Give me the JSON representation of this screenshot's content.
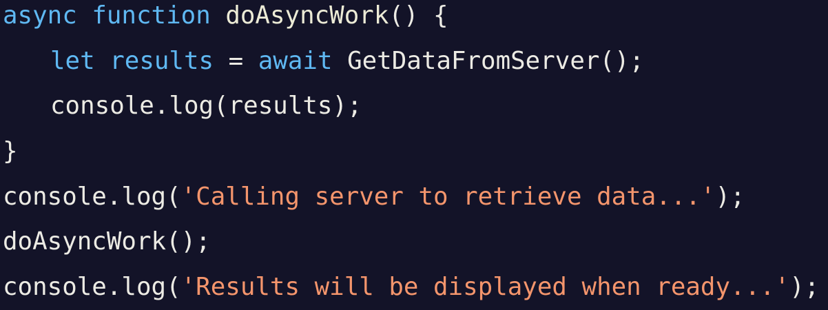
{
  "code": {
    "lines": [
      {
        "kw1": "async",
        "kw2": "function",
        "name": "doAsyncWork",
        "rest": "() {"
      },
      {
        "kw1": "let",
        "var": "results",
        "op": " = ",
        "kw2": "await",
        "rest": " GetDataFromServer();"
      },
      {
        "text": "console.log(results);"
      },
      {
        "text": "}"
      },
      {
        "pre": "console.log(",
        "str": "'Calling server to retrieve data...'",
        "post": ");"
      },
      {
        "text": "doAsyncWork();"
      },
      {
        "pre": "console.log(",
        "str": "'Results will be displayed when ready...'",
        "post": ");"
      }
    ]
  },
  "colors": {
    "background": "#131328",
    "keyword": "#5fb8f2",
    "string": "#f4956c",
    "text": "#ecebe4"
  }
}
